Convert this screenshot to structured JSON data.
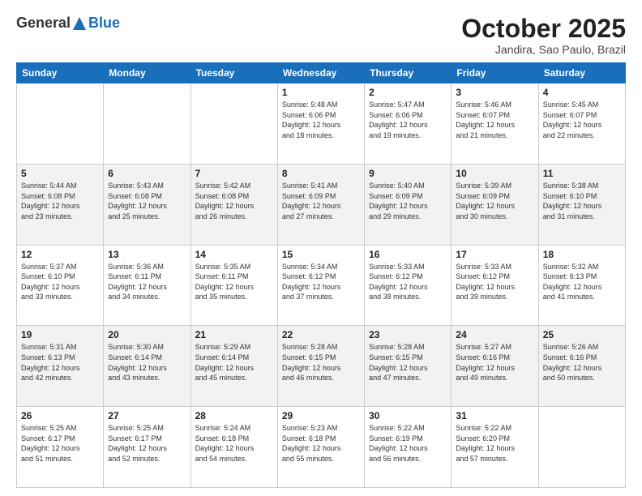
{
  "header": {
    "logo_general": "General",
    "logo_blue": "Blue",
    "month_title": "October 2025",
    "location": "Jandira, Sao Paulo, Brazil"
  },
  "days_of_week": [
    "Sunday",
    "Monday",
    "Tuesday",
    "Wednesday",
    "Thursday",
    "Friday",
    "Saturday"
  ],
  "weeks": [
    [
      {
        "day": "",
        "info": ""
      },
      {
        "day": "",
        "info": ""
      },
      {
        "day": "",
        "info": ""
      },
      {
        "day": "1",
        "info": "Sunrise: 5:48 AM\nSunset: 6:06 PM\nDaylight: 12 hours\nand 18 minutes."
      },
      {
        "day": "2",
        "info": "Sunrise: 5:47 AM\nSunset: 6:06 PM\nDaylight: 12 hours\nand 19 minutes."
      },
      {
        "day": "3",
        "info": "Sunrise: 5:46 AM\nSunset: 6:07 PM\nDaylight: 12 hours\nand 21 minutes."
      },
      {
        "day": "4",
        "info": "Sunrise: 5:45 AM\nSunset: 6:07 PM\nDaylight: 12 hours\nand 22 minutes."
      }
    ],
    [
      {
        "day": "5",
        "info": "Sunrise: 5:44 AM\nSunset: 6:08 PM\nDaylight: 12 hours\nand 23 minutes."
      },
      {
        "day": "6",
        "info": "Sunrise: 5:43 AM\nSunset: 6:08 PM\nDaylight: 12 hours\nand 25 minutes."
      },
      {
        "day": "7",
        "info": "Sunrise: 5:42 AM\nSunset: 6:08 PM\nDaylight: 12 hours\nand 26 minutes."
      },
      {
        "day": "8",
        "info": "Sunrise: 5:41 AM\nSunset: 6:09 PM\nDaylight: 12 hours\nand 27 minutes."
      },
      {
        "day": "9",
        "info": "Sunrise: 5:40 AM\nSunset: 6:09 PM\nDaylight: 12 hours\nand 29 minutes."
      },
      {
        "day": "10",
        "info": "Sunrise: 5:39 AM\nSunset: 6:09 PM\nDaylight: 12 hours\nand 30 minutes."
      },
      {
        "day": "11",
        "info": "Sunrise: 5:38 AM\nSunset: 6:10 PM\nDaylight: 12 hours\nand 31 minutes."
      }
    ],
    [
      {
        "day": "12",
        "info": "Sunrise: 5:37 AM\nSunset: 6:10 PM\nDaylight: 12 hours\nand 33 minutes."
      },
      {
        "day": "13",
        "info": "Sunrise: 5:36 AM\nSunset: 6:11 PM\nDaylight: 12 hours\nand 34 minutes."
      },
      {
        "day": "14",
        "info": "Sunrise: 5:35 AM\nSunset: 6:11 PM\nDaylight: 12 hours\nand 35 minutes."
      },
      {
        "day": "15",
        "info": "Sunrise: 5:34 AM\nSunset: 6:12 PM\nDaylight: 12 hours\nand 37 minutes."
      },
      {
        "day": "16",
        "info": "Sunrise: 5:33 AM\nSunset: 6:12 PM\nDaylight: 12 hours\nand 38 minutes."
      },
      {
        "day": "17",
        "info": "Sunrise: 5:33 AM\nSunset: 6:12 PM\nDaylight: 12 hours\nand 39 minutes."
      },
      {
        "day": "18",
        "info": "Sunrise: 5:32 AM\nSunset: 6:13 PM\nDaylight: 12 hours\nand 41 minutes."
      }
    ],
    [
      {
        "day": "19",
        "info": "Sunrise: 5:31 AM\nSunset: 6:13 PM\nDaylight: 12 hours\nand 42 minutes."
      },
      {
        "day": "20",
        "info": "Sunrise: 5:30 AM\nSunset: 6:14 PM\nDaylight: 12 hours\nand 43 minutes."
      },
      {
        "day": "21",
        "info": "Sunrise: 5:29 AM\nSunset: 6:14 PM\nDaylight: 12 hours\nand 45 minutes."
      },
      {
        "day": "22",
        "info": "Sunrise: 5:28 AM\nSunset: 6:15 PM\nDaylight: 12 hours\nand 46 minutes."
      },
      {
        "day": "23",
        "info": "Sunrise: 5:28 AM\nSunset: 6:15 PM\nDaylight: 12 hours\nand 47 minutes."
      },
      {
        "day": "24",
        "info": "Sunrise: 5:27 AM\nSunset: 6:16 PM\nDaylight: 12 hours\nand 49 minutes."
      },
      {
        "day": "25",
        "info": "Sunrise: 5:26 AM\nSunset: 6:16 PM\nDaylight: 12 hours\nand 50 minutes."
      }
    ],
    [
      {
        "day": "26",
        "info": "Sunrise: 5:25 AM\nSunset: 6:17 PM\nDaylight: 12 hours\nand 51 minutes."
      },
      {
        "day": "27",
        "info": "Sunrise: 5:25 AM\nSunset: 6:17 PM\nDaylight: 12 hours\nand 52 minutes."
      },
      {
        "day": "28",
        "info": "Sunrise: 5:24 AM\nSunset: 6:18 PM\nDaylight: 12 hours\nand 54 minutes."
      },
      {
        "day": "29",
        "info": "Sunrise: 5:23 AM\nSunset: 6:18 PM\nDaylight: 12 hours\nand 55 minutes."
      },
      {
        "day": "30",
        "info": "Sunrise: 5:22 AM\nSunset: 6:19 PM\nDaylight: 12 hours\nand 56 minutes."
      },
      {
        "day": "31",
        "info": "Sunrise: 5:22 AM\nSunset: 6:20 PM\nDaylight: 12 hours\nand 57 minutes."
      },
      {
        "day": "",
        "info": ""
      }
    ]
  ]
}
